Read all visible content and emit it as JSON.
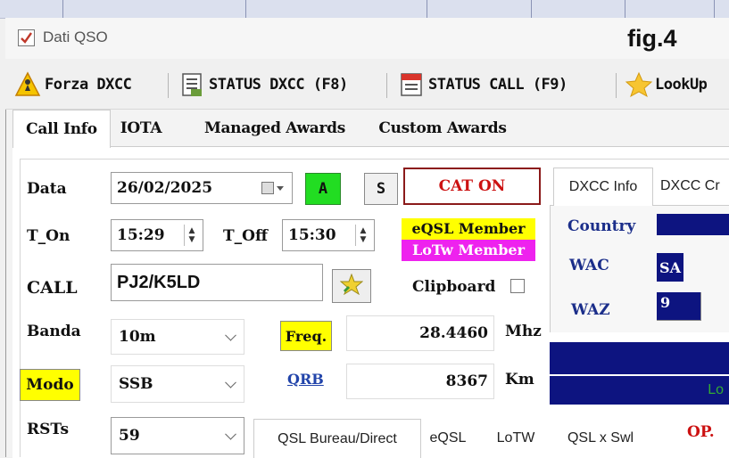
{
  "window": {
    "title": "Dati QSO",
    "figure_label": "fig.4"
  },
  "toolbar": {
    "force_dxcc": "Forza DXCC",
    "status_dxcc": "STATUS DXCC (F8)",
    "status_call": "STATUS CALL (F9)",
    "lookup": "LookUp"
  },
  "tabs": [
    "Call Info",
    "IOTA",
    "Managed Awards",
    "Custom Awards"
  ],
  "form": {
    "data_label": "Data",
    "data_value": "26/02/2025",
    "btn_a": "A",
    "btn_s": "S",
    "cat_on": "CAT ON",
    "t_on_label": "T_On",
    "t_on_value": "15:29",
    "t_off_label": "T_Off",
    "t_off_value": "15:30",
    "eqsl_member": "eQSL Member",
    "lotw_member": "LoTw Member",
    "call_label": "CALL",
    "call_value": "PJ2/K5LD",
    "clipboard_label": "Clipboard",
    "banda_label": "Banda",
    "banda_value": "10m",
    "freq_label": "Freq.",
    "freq_value": "28.4460",
    "freq_unit": "Mhz",
    "modo_label": "Modo",
    "modo_value": "SSB",
    "qrb_label": "QRB",
    "qrb_value": "8367",
    "qrb_unit": "Km",
    "rsts_label": "RSTs",
    "rsts_value": "59"
  },
  "dxcc_panel": {
    "tabs": [
      "DXCC Info",
      "DXCC Cr"
    ],
    "country_label": "Country",
    "wac_label": "WAC",
    "wac_value": "SA",
    "waz_label": "WAZ",
    "waz_value": "9",
    "lo_text": "Lo"
  },
  "qsl_tabs": [
    "QSL Bureau/Direct",
    "eQSL",
    "LoTW",
    "QSL x Swl"
  ],
  "op_label": "OP.",
  "colors": {
    "accent_green": "#22dd22",
    "cat_red": "#cc1111",
    "member_yellow": "#ffff00",
    "member_magenta": "#ee22ee",
    "navy": "#0d1480"
  }
}
